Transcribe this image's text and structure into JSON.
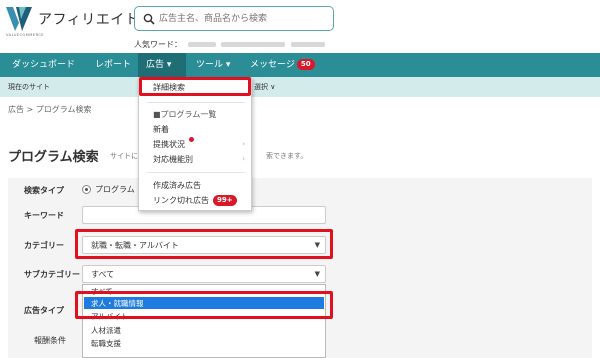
{
  "header": {
    "brand": "アフィリエイト",
    "logo_sub": "VALUECOMMERCE",
    "search_placeholder": "広告主名、商品名から検索",
    "popular_label": "人気ワード："
  },
  "nav": {
    "items": [
      {
        "label": "ダッシュボード"
      },
      {
        "label": "レポート"
      },
      {
        "label": "広告 ▾"
      },
      {
        "label": "ツール ▾"
      },
      {
        "label": "メッセージ"
      }
    ],
    "message_badge": "50"
  },
  "subnav": {
    "current_site": "現在のサイト",
    "select": "選択 ∨"
  },
  "breadcrumb": "広告 > プログラム検索",
  "page": {
    "title": "プログラム検索",
    "desc_left": "サイトに",
    "desc_right": "索できます。"
  },
  "form": {
    "search_type_label": "検索タイプ",
    "search_type_value": "プログラム",
    "keyword_label": "キーワード",
    "category_label": "カテゴリー",
    "category_value": "就職・転職・アルバイト",
    "subcategory_label": "サブカテゴリー",
    "subcategory_value": "すべて",
    "ad_type_label": "広告タイプ",
    "reward_label": "報酬条件",
    "subcategory_options": [
      "すべて",
      "求人・就職情報",
      "アルバイト",
      "人材派遣",
      "転職支援"
    ],
    "subcategory_selected": "求人・就職情報"
  },
  "menu": {
    "items": [
      {
        "label": "詳細検索"
      },
      {
        "label": "■プログラム一覧"
      },
      {
        "label": "新着"
      },
      {
        "label": "提携状況"
      },
      {
        "label": "対応機能別"
      },
      {
        "label": "作成済み広告"
      },
      {
        "label": "リンク切れ広告"
      }
    ],
    "broken_link_badge": "99+"
  },
  "colors": {
    "nav_bg": "#2b8e96",
    "subnav_bg": "#d3ebea",
    "highlight_red": "#e0101e",
    "badge_red": "#d7192a",
    "option_selected": "#1e7be0"
  }
}
